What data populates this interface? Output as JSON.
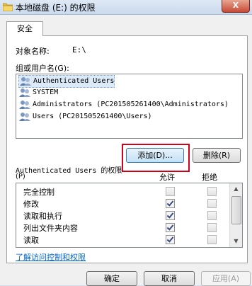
{
  "window": {
    "title": "本地磁盘 (E:) 的权限",
    "close_label": "X"
  },
  "tab": {
    "label": "安全"
  },
  "object": {
    "label": "对象名称:",
    "value": "E:\\"
  },
  "group_list": {
    "label": "组或用户名(G):",
    "users": [
      {
        "name": "Authenticated Users",
        "icon": "user-group-icon"
      },
      {
        "name": "SYSTEM",
        "icon": "user-group-icon"
      },
      {
        "name": "Administrators (PC201505261400\\Administrators)",
        "icon": "user-group-icon"
      },
      {
        "name": "Users (PC201505261400\\Users)",
        "icon": "user-group-icon"
      }
    ]
  },
  "actions": {
    "add_label": "添加(D)...",
    "remove_label": "删除(R)"
  },
  "permissions": {
    "heading_line1": "Authenticated Users 的权限",
    "heading_line2": "(P)",
    "allow_header": "允许",
    "deny_header": "拒绝",
    "items": [
      {
        "name": "完全控制",
        "allow": false,
        "deny": false
      },
      {
        "name": "修改",
        "allow": true,
        "deny": false
      },
      {
        "name": "读取和执行",
        "allow": true,
        "deny": false
      },
      {
        "name": "列出文件夹内容",
        "allow": true,
        "deny": false
      },
      {
        "name": "读取",
        "allow": true,
        "deny": false
      }
    ]
  },
  "help_link": "了解访问控制和权限",
  "footer": {
    "ok_label": "确定",
    "cancel_label": "取消",
    "apply_label": "应用(A)"
  },
  "colors": {
    "highlight_box": "#d0021b",
    "link": "#0066cc"
  }
}
